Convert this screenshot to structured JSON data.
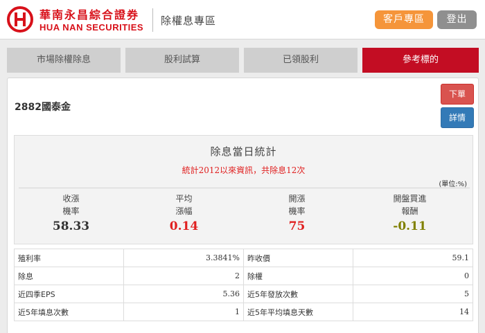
{
  "header": {
    "brand_zh": "華南永昌綜合證券",
    "brand_en": "HUA NAN SECURITIES",
    "section_title": "除權息專區",
    "client_button": "客戶專區",
    "logout_button": "登出",
    "brand_color": "#d8111a"
  },
  "tabs": [
    {
      "label": "市場除權除息",
      "active": false
    },
    {
      "label": "股利試算",
      "active": false
    },
    {
      "label": "已領股利",
      "active": false
    },
    {
      "label": "參考標的",
      "active": true
    }
  ],
  "stock": {
    "name": "2882國泰金",
    "order_button": "下單",
    "detail_button": "詳情"
  },
  "stats": {
    "title": "除息當日統計",
    "subtitle": "統計2012以來資訊，共除息12次",
    "unit": "(單位:%)",
    "items": [
      {
        "label1": "收漲",
        "label2": "機率",
        "value": "58.33",
        "color": "#333333"
      },
      {
        "label1": "平均",
        "label2": "漲幅",
        "value": "0.14",
        "color": "#e02020"
      },
      {
        "label1": "開漲",
        "label2": "機率",
        "value": "75",
        "color": "#e02020"
      },
      {
        "label1": "開盤買進",
        "label2": "報酬",
        "value": "-0.11",
        "color": "#808000"
      }
    ]
  },
  "info_rows": [
    {
      "l1": "殖利率",
      "v1": "3.3841%",
      "l2": "昨收價",
      "v2": "59.1"
    },
    {
      "l1": "除息",
      "v1": "2",
      "l2": "除權",
      "v2": "0"
    },
    {
      "l1": "近四季EPS",
      "v1": "5.36",
      "l2": "近5年發放次數",
      "v2": "5"
    },
    {
      "l1": "近5年填息次數",
      "v1": "1",
      "l2": "近5年平均填息天數",
      "v2": "14"
    }
  ]
}
